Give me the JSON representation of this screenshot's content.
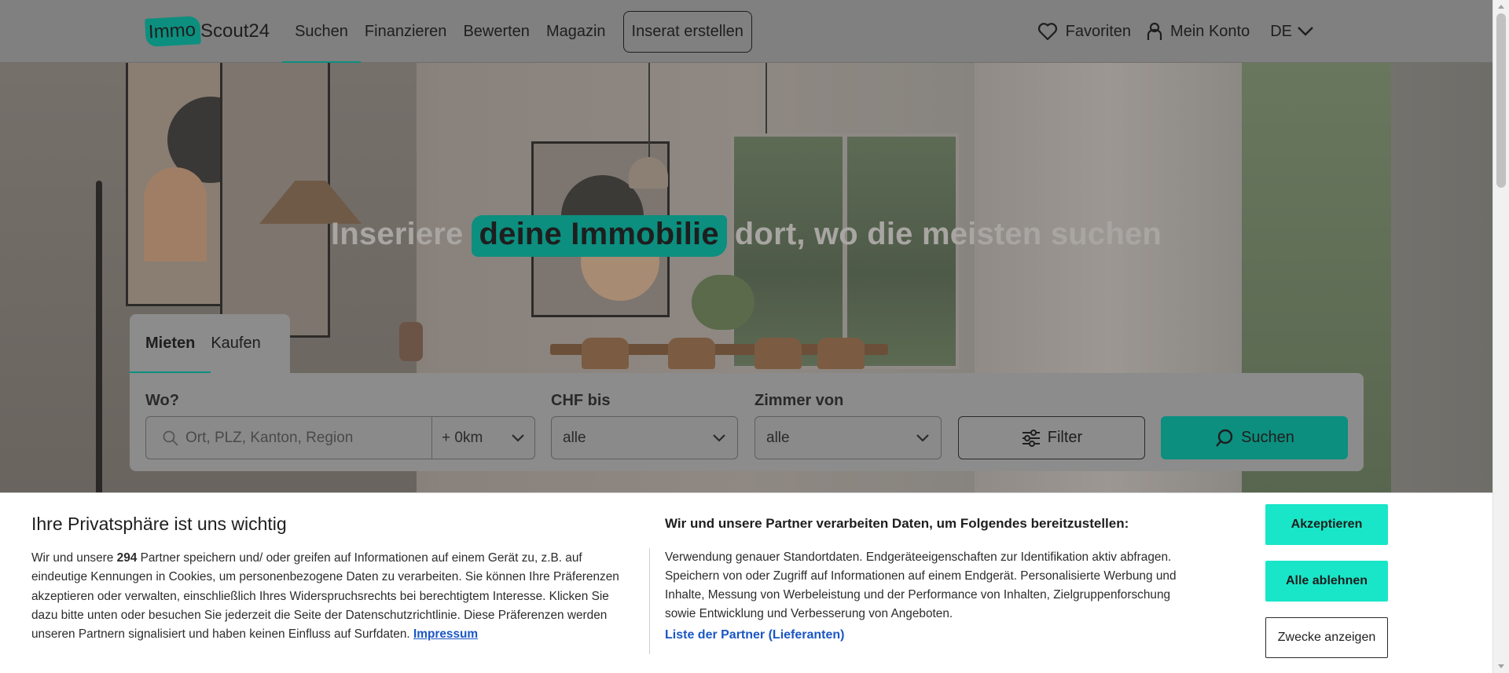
{
  "header": {
    "logo": {
      "part1": "Immo",
      "part2": "Scout24"
    },
    "nav": [
      "Suchen",
      "Finanzieren",
      "Bewerten",
      "Magazin"
    ],
    "cta": "Inserat erstellen",
    "favorites": "Favoriten",
    "account": "Mein Konto",
    "language": "DE"
  },
  "hero": {
    "headline_before": "Inseriere",
    "headline_highlight": "deine Immobilie",
    "headline_after": "dort, wo die meisten suchen"
  },
  "search": {
    "tabs": [
      "Mieten",
      "Kaufen"
    ],
    "active_tab": "Mieten",
    "where_label": "Wo?",
    "where_placeholder": "Ort, PLZ, Kanton, Region",
    "radius": "+ 0km",
    "price_label": "CHF bis",
    "price_value": "alle",
    "rooms_label": "Zimmer von",
    "rooms_value": "alle",
    "filter_button": "Filter",
    "search_button": "Suchen"
  },
  "cookie": {
    "title": "Ihre Privatsphäre ist uns wichtig",
    "text_before": "Wir und unsere ",
    "partner_count": "294",
    "text_after": " Partner speichern und/ oder greifen auf Informationen auf einem Gerät zu, z.B. auf eindeutige Kennungen in Cookies, um personenbezogene Daten zu verarbeiten. Sie können Ihre Präferenzen akzeptieren oder verwalten, einschließlich Ihres Widerspruchsrechts bei berechtigtem Interesse. Klicken Sie dazu bitte unten oder besuchen Sie jederzeit die Seite der Datenschutzrichtlinie. Diese Präferenzen werden unseren Partnern signalisiert und haben keinen Einfluss auf Surfdaten.",
    "impressum_link": "Impressum",
    "purposes_title": "Wir und unsere Partner verarbeiten Daten, um Folgendes bereitzustellen:",
    "purposes_text": "Verwendung genauer Standortdaten. Endgeräteeigenschaften zur Identifikation aktiv abfragen. Speichern von oder Zugriff auf Informationen auf einem Endgerät. Personalisierte Werbung und Inhalte, Messung von Werbeleistung und der Performance von Inhalten, Zielgruppenforschung sowie Entwicklung und Verbesserung von Angeboten.",
    "partners_link": "Liste der Partner (Lieferanten)",
    "accept_button": "Akzeptieren",
    "reject_button": "Alle ablehnen",
    "purposes_button": "Zwecke anzeigen"
  },
  "colors": {
    "brand": "#0c8f7f",
    "cookie_button": "#19e6c8",
    "link": "#1a56c4"
  }
}
